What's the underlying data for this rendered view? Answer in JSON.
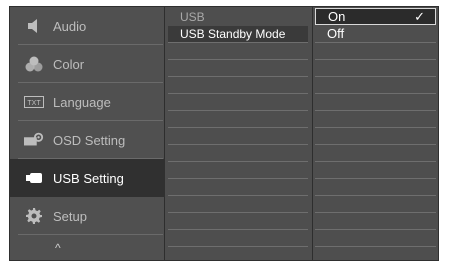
{
  "menu": {
    "items": [
      {
        "label": "Audio",
        "icon": "speaker-icon"
      },
      {
        "label": "Color",
        "icon": "color-circles-icon"
      },
      {
        "label": "Language",
        "icon": "text-box-icon",
        "icon_text": "TXT"
      },
      {
        "label": "OSD Setting",
        "icon": "monitor-gear-icon"
      },
      {
        "label": "USB Setting",
        "icon": "usb-plug-icon",
        "selected": true
      },
      {
        "label": "Setup",
        "icon": "gear-icon"
      }
    ],
    "up_arrow": "^"
  },
  "submenu": {
    "header": "USB",
    "items": [
      "USB Standby Mode"
    ]
  },
  "options": {
    "items": [
      {
        "label": "On",
        "selected": true,
        "check": "✓"
      },
      {
        "label": "Off",
        "selected": false
      }
    ]
  },
  "colors": {
    "panel": "#4b4b4b",
    "selected_menu": "#303030",
    "text": "#bdbdbd"
  }
}
